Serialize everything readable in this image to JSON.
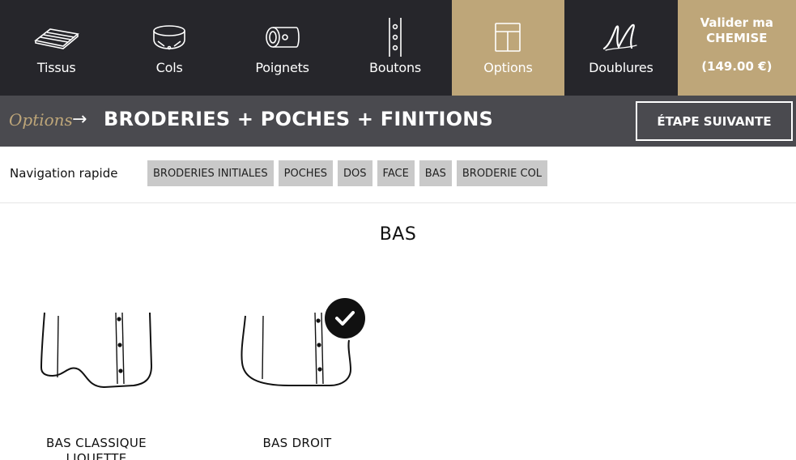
{
  "nav": {
    "items": [
      {
        "label": "Tissus",
        "icon": "fabric-icon"
      },
      {
        "label": "Cols",
        "icon": "collar-icon"
      },
      {
        "label": "Poignets",
        "icon": "cuff-icon"
      },
      {
        "label": "Boutons",
        "icon": "buttons-icon"
      },
      {
        "label": "Options",
        "icon": "options-icon",
        "active": true
      },
      {
        "label": "Doublures",
        "icon": "monogram-icon"
      }
    ],
    "validate": {
      "line1": "Valider ma",
      "line2": "CHEMISE",
      "price": "(149.00 €)"
    }
  },
  "step": {
    "category": "Options",
    "title": "BRODERIES + POCHES + FINITIONS",
    "next_label": "ÉTAPE SUIVANTE"
  },
  "quicknav": {
    "label": "Navigation rapide",
    "chips": [
      "BRODERIES INITIALES",
      "POCHES",
      "DOS",
      "FACE",
      "BAS",
      "BRODERIE COL"
    ]
  },
  "section": {
    "title": "BAS",
    "options": [
      {
        "line1": "BAS CLASSIQUE",
        "line2": "LIQUETTE",
        "selected": false
      },
      {
        "line1": "BAS DROIT",
        "line2": "",
        "selected": true
      }
    ]
  },
  "colors": {
    "accent": "#bea679",
    "nav_bg": "#26262b",
    "step_bg": "#4a4a4f"
  }
}
